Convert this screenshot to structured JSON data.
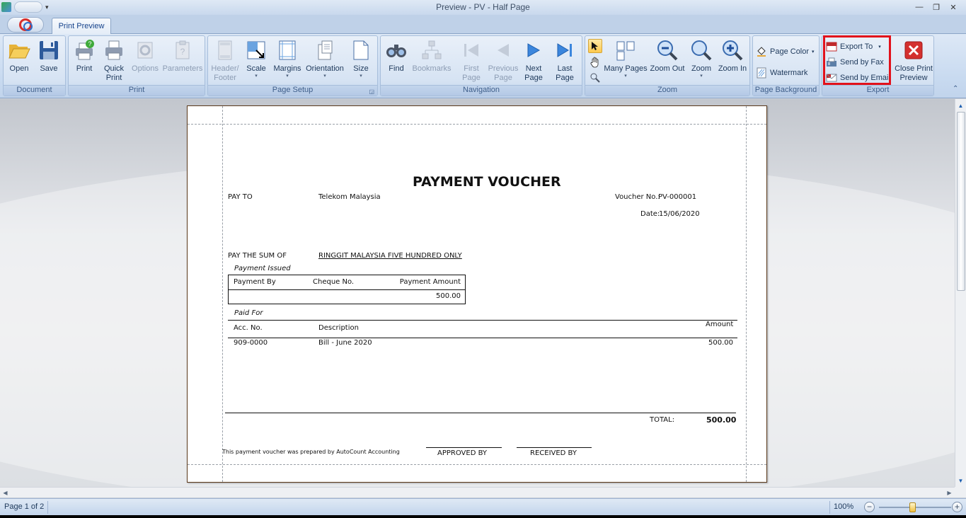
{
  "window": {
    "title": "Preview - PV - Half Page"
  },
  "tabs": {
    "active": "Print Preview"
  },
  "ribbon": {
    "document": {
      "label": "Document",
      "open": "Open",
      "save": "Save"
    },
    "print": {
      "label": "Print",
      "print": "Print",
      "quick_print_1": "Quick",
      "quick_print_2": "Print",
      "options": "Options",
      "parameters": "Parameters"
    },
    "page_setup": {
      "label": "Page Setup",
      "header_footer_1": "Header/",
      "header_footer_2": "Footer",
      "scale": "Scale",
      "margins": "Margins",
      "orientation": "Orientation",
      "size": "Size"
    },
    "navigation": {
      "label": "Navigation",
      "find": "Find",
      "bookmarks": "Bookmarks",
      "first_1": "First",
      "first_2": "Page",
      "prev_1": "Previous",
      "prev_2": "Page",
      "next_1": "Next",
      "next_2": "Page",
      "last_1": "Last",
      "last_2": "Page"
    },
    "zoom": {
      "label": "Zoom",
      "many_pages": "Many Pages",
      "zoom_out": "Zoom Out",
      "zoom": "Zoom",
      "zoom_in": "Zoom In"
    },
    "page_background": {
      "label": "Page Background",
      "page_color": "Page Color",
      "watermark": "Watermark"
    },
    "export": {
      "label": "Export",
      "export_to": "Export To",
      "send_fax": "Send by Fax",
      "send_email": "Send by Email",
      "close_1": "Close Print",
      "close_2": "Preview"
    }
  },
  "voucher": {
    "title": "PAYMENT VOUCHER",
    "pay_to_label": "PAY TO",
    "pay_to_value": "Telekom Malaysia",
    "voucher_no_label": "Voucher No.:",
    "voucher_no_value": "PV-000001",
    "date_label": "Date:",
    "date_value": "15/06/2020",
    "sum_label": "PAY THE SUM OF",
    "sum_value": "RINGGIT MALAYSIA FIVE HUNDRED ONLY",
    "payment_issued": "Payment Issued",
    "payment_cols": [
      "Payment By",
      "Cheque No.",
      "Payment Amount"
    ],
    "payment_amount": "500.00",
    "paid_for": "Paid For",
    "detail_cols": [
      "Acc. No.",
      "Description",
      "Amount"
    ],
    "rows": [
      {
        "acc": "909-0000",
        "desc": "Bill - June 2020",
        "amount": "500.00"
      }
    ],
    "total_label": "TOTAL:",
    "total_value": "500.00",
    "footer_note": "This payment voucher was prepared by AutoCount Accounting",
    "approved_by": "APPROVED  BY",
    "received_by": "RECEIVED  BY"
  },
  "status": {
    "page": "Page 1 of 2",
    "zoom": "100%"
  },
  "colors": {
    "highlight": "#e2111b",
    "ribbon_text": "#1e395b"
  }
}
